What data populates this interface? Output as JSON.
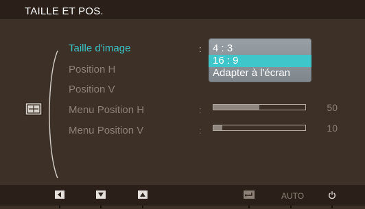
{
  "header": {
    "title": "TAILLE ET POS."
  },
  "menu": {
    "items": [
      {
        "label": "Taille d'image",
        "active": true
      },
      {
        "label": "Position H",
        "active": false
      },
      {
        "label": "Position V",
        "active": false
      },
      {
        "label": "Menu Position H",
        "active": false
      },
      {
        "label": "Menu Position V",
        "active": false
      }
    ]
  },
  "dropdown": {
    "options": [
      "4 : 3",
      "16 : 9",
      "Adapter à l'écran"
    ],
    "selected": "16 : 9"
  },
  "sliders": {
    "menu_position_h": {
      "value": "50",
      "level": 0.5
    },
    "menu_position_v": {
      "value": "10",
      "level": 0.1
    }
  },
  "footer": {
    "auto_label": "AUTO",
    "buttons": [
      "left-arrow-icon",
      "down-arrow-icon",
      "up-arrow-icon",
      "enter-icon",
      "auto-button",
      "power-icon"
    ]
  },
  "colors": {
    "accent": "#3cc3c7",
    "background": "#3d3026",
    "title_bar": "#2b2019",
    "muted_text": "#8e8178"
  }
}
